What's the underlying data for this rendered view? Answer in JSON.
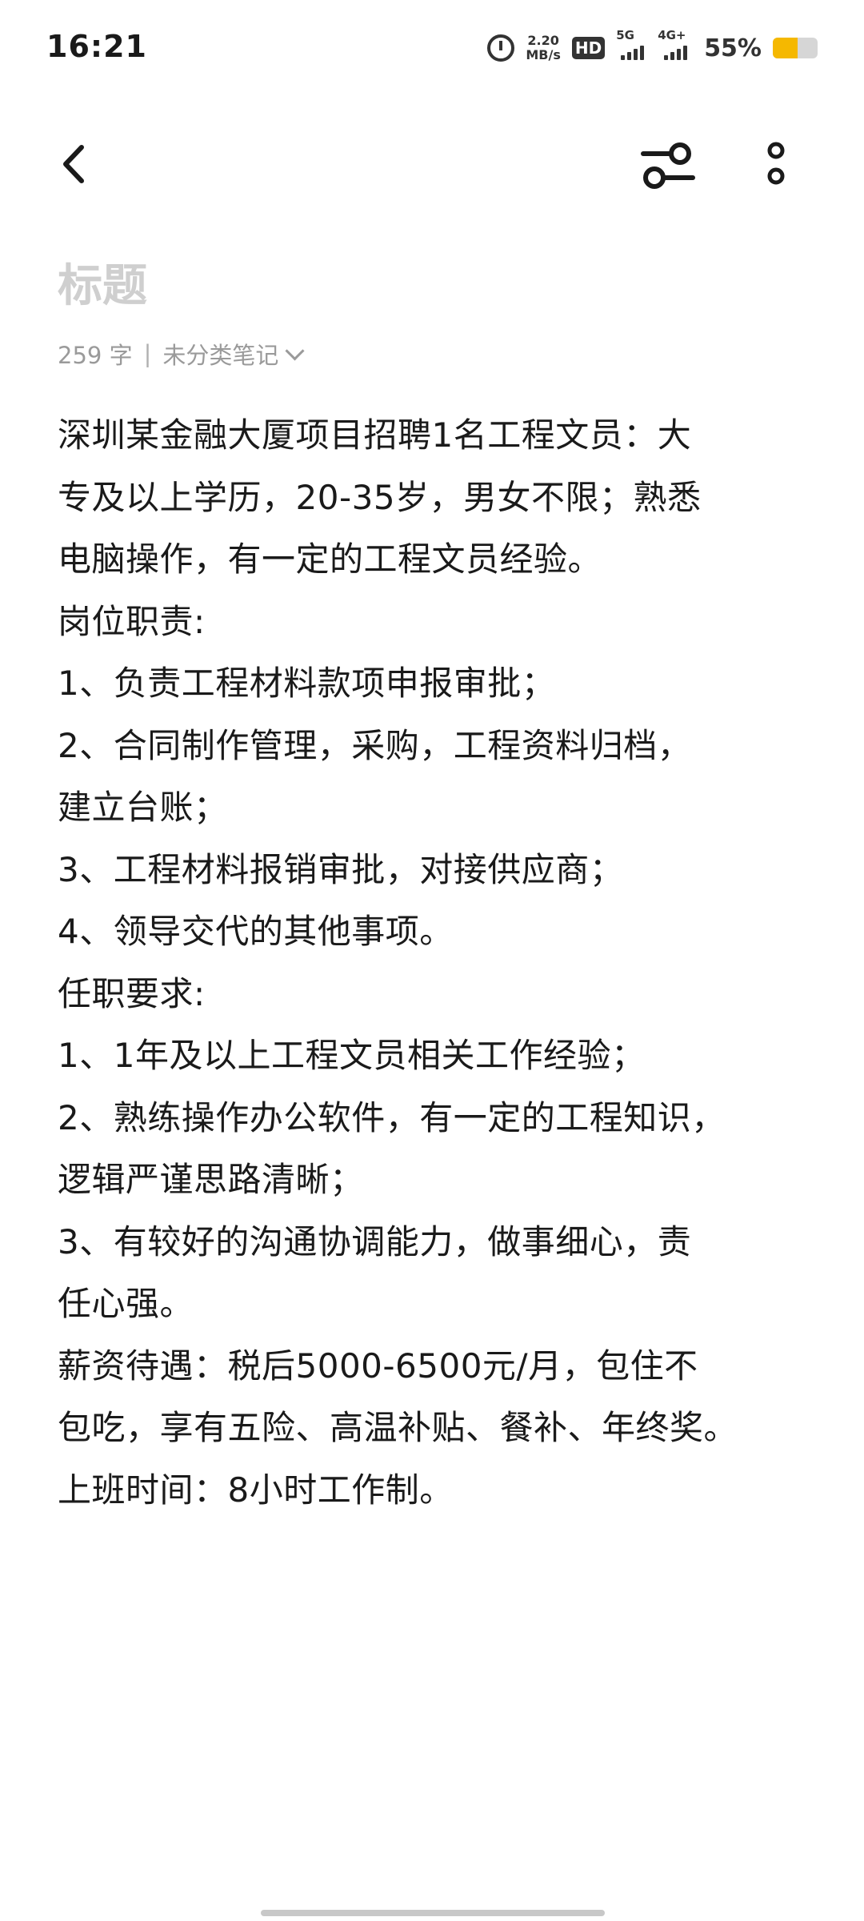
{
  "status_bar": {
    "time": "16:21",
    "net_speed_value": "2.20",
    "net_speed_unit": "MB/s",
    "hd_label": "HD",
    "sim1_label": "5G",
    "sim2_label": "4G+",
    "battery_percent_text": "55%",
    "battery_level": 0.55,
    "battery_color": "#f5b800"
  },
  "toolbar": {
    "back_icon": "chevron-left-icon",
    "filter_icon": "sliders-icon",
    "more_icon": "more-vertical-icon"
  },
  "note": {
    "title_placeholder": "标题",
    "char_count": "259 字",
    "separator": "|",
    "category": "未分类笔记",
    "lines": [
      "深圳某金融大厦项目招聘1名工程文员：大",
      "专及以上学历，20-35岁，男女不限；熟悉",
      "电脑操作，有一定的工程文员经验。",
      "岗位职责:",
      "1、负责工程材料款项申报审批；",
      "2、合同制作管理，采购，工程资料归档，",
      "建立台账；",
      "3、工程材料报销审批，对接供应商；",
      "4、领导交代的其他事项。",
      "任职要求:",
      "1、1年及以上工程文员相关工作经验；",
      "2、熟练操作办公软件，有一定的工程知识，",
      "逻辑严谨思路清晰；",
      "3、有较好的沟通协调能力，做事细心，责",
      "任心强。",
      "薪资待遇：税后5000-6500元/月，包住不",
      "包吃，享有五险、高温补贴、餐补、年终奖。",
      "上班时间：8小时工作制。"
    ]
  }
}
